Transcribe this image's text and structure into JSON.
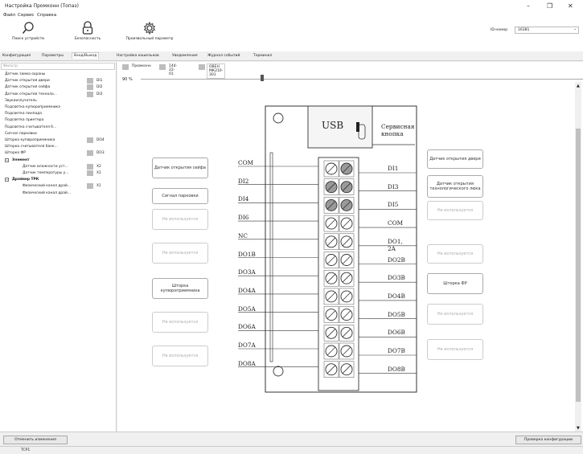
{
  "window": {
    "title": "Настройка Промконн (Топаз)",
    "controls": [
      "–",
      "❐",
      "✕"
    ]
  },
  "menu": [
    "Файл",
    "Сервис",
    "Справка"
  ],
  "toolbar": {
    "items": [
      {
        "label": "Поиск устройств",
        "icon": "search-icon"
      },
      {
        "label": "Безопасность",
        "icon": "lock-icon"
      },
      {
        "label": "Произвольный параметр",
        "icon": "gear-icon"
      }
    ],
    "id_label": "ID-номер",
    "id_value": "16381"
  },
  "tabs": [
    "Конфигурация",
    "Параметры",
    "Вход/Выход",
    "Настройка кошельков",
    "Уведомления",
    "Журнал событий",
    "Терминал"
  ],
  "active_tab": 2,
  "filter_placeholder": "Фильтр",
  "tree": [
    {
      "label": "Датчик замка охраны",
      "chip": false,
      "code": ""
    },
    {
      "label": "Датчик открытия двери",
      "chip": true,
      "code": "DI1"
    },
    {
      "label": "Датчик открытия сейфа",
      "chip": true,
      "code": "DI2"
    },
    {
      "label": "Датчик открытия техноло...",
      "chip": true,
      "code": "DI3"
    },
    {
      "label": "Звукоизлучатель",
      "chip": false,
      "code": ""
    },
    {
      "label": "Подсветка купюроприемника",
      "chip": false,
      "code": ""
    },
    {
      "label": "Подсветка пинпада",
      "chip": false,
      "code": ""
    },
    {
      "label": "Подсветка принтера",
      "chip": false,
      "code": ""
    },
    {
      "label": "Подсветка считывателя б...",
      "chip": false,
      "code": ""
    },
    {
      "label": "Сигнал парковки",
      "chip": false,
      "code": ""
    },
    {
      "label": "Шторка купюроприемника",
      "chip": true,
      "code": "DO4"
    },
    {
      "label": "Шторка считывателя банк...",
      "chip": false,
      "code": ""
    },
    {
      "label": "Шторка ФР",
      "chip": true,
      "code": "DO3"
    },
    {
      "label": "Элемент",
      "group": true
    },
    {
      "label": "Датчик влажности уст...",
      "chip": true,
      "code": "X2",
      "indent": 2
    },
    {
      "label": "Датчик температуры у...",
      "chip": true,
      "code": "X1",
      "indent": 2
    },
    {
      "label": "Драйвер ТРК",
      "group": true
    },
    {
      "label": "Физический канал драй...",
      "chip": true,
      "code": "X1",
      "indent": 2
    },
    {
      "label": "Физический канал драй...",
      "chip": false,
      "code": "",
      "indent": 2
    }
  ],
  "subtabs": [
    "Промконн",
    "144-22-01",
    "ОВЕН МК210-301"
  ],
  "zoom": "90 %",
  "zoom_level": 0.27,
  "device": {
    "usb_label": "USB",
    "service_button": "Сервисная кнопка",
    "left_pins": [
      "COM",
      "DI2",
      "DI4",
      "DI6",
      "NC",
      "DO1B",
      "DO3A",
      "DO4A",
      "DO5A",
      "DO6A",
      "DO7A",
      "DO8A"
    ],
    "right_pins": [
      "DI1",
      "DI3",
      "DI5",
      "COM",
      "DO1, 2A",
      "DO2B",
      "DO3B",
      "DO4B",
      "DO5B",
      "DO6B",
      "DO7B",
      "DO8B"
    ]
  },
  "left_boxes": [
    {
      "text": "Датчик открытия сейфа",
      "muted": false
    },
    {
      "text": "Сигнал парковки",
      "muted": false
    },
    {
      "text": "Не используется",
      "muted": true
    },
    {
      "text": "Не используется",
      "muted": true
    },
    {
      "text": "Шторка купюроприемника",
      "muted": false
    },
    {
      "text": "Не используется",
      "muted": true
    },
    {
      "text": "Не используется",
      "muted": true
    }
  ],
  "right_boxes": [
    {
      "text": "Датчик открытия двери",
      "muted": false
    },
    {
      "text": "Датчик открытия технологического люка",
      "muted": false
    },
    {
      "text": "Не используется",
      "muted": true
    },
    {
      "text": "Не используется",
      "muted": true
    },
    {
      "text": "Шторка ФР",
      "muted": false
    },
    {
      "text": "Не используется",
      "muted": true
    },
    {
      "text": "Не используется",
      "muted": true
    }
  ],
  "buttons": {
    "revert": "Отменить изменения",
    "check": "Проверка конфигурации"
  },
  "status": "TCP1"
}
